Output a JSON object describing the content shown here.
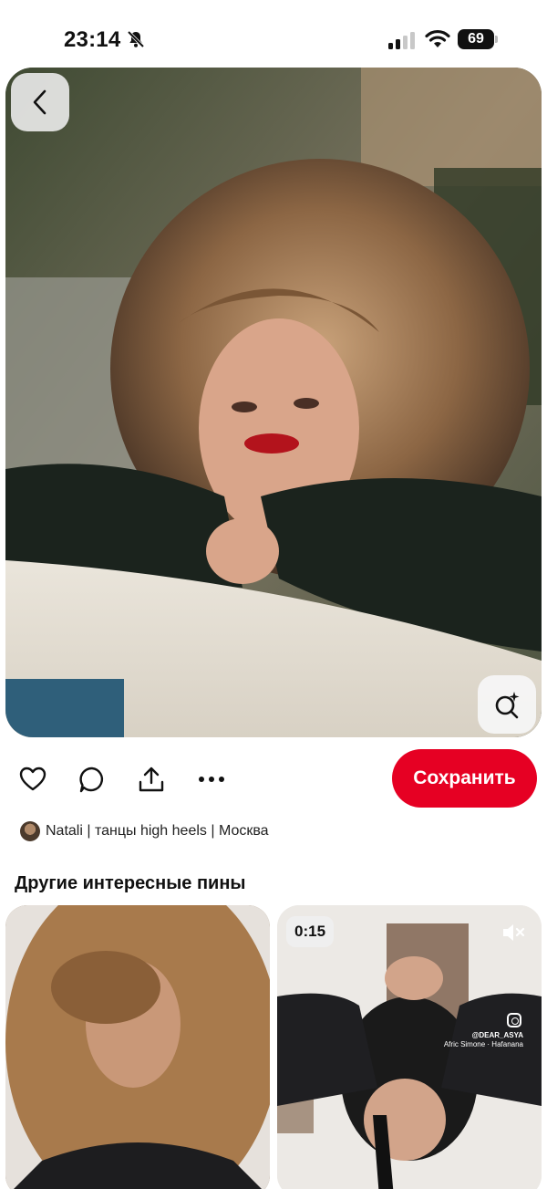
{
  "status_bar": {
    "time": "23:14",
    "battery": "69",
    "icons": [
      "bell-slash-icon",
      "signal-icon",
      "wifi-icon",
      "battery-icon"
    ]
  },
  "pin": {
    "back_icon": "chevron-left-icon",
    "lens_icon": "visual-search-icon"
  },
  "actions": {
    "icons": [
      "heart-icon",
      "comment-icon",
      "share-icon",
      "more-icon"
    ],
    "save_label": "Сохранить",
    "save_color": "#e60023"
  },
  "author": {
    "name": "Natali | танцы high heels | Москва"
  },
  "more_pins": {
    "title": "Другие интересные пины",
    "cards": [
      {
        "kind": "image"
      },
      {
        "kind": "video",
        "duration": "0:15",
        "watermark_handle": "@DEAR_ASYA",
        "watermark_credit": "Afric Simone · Hafanana"
      }
    ]
  }
}
